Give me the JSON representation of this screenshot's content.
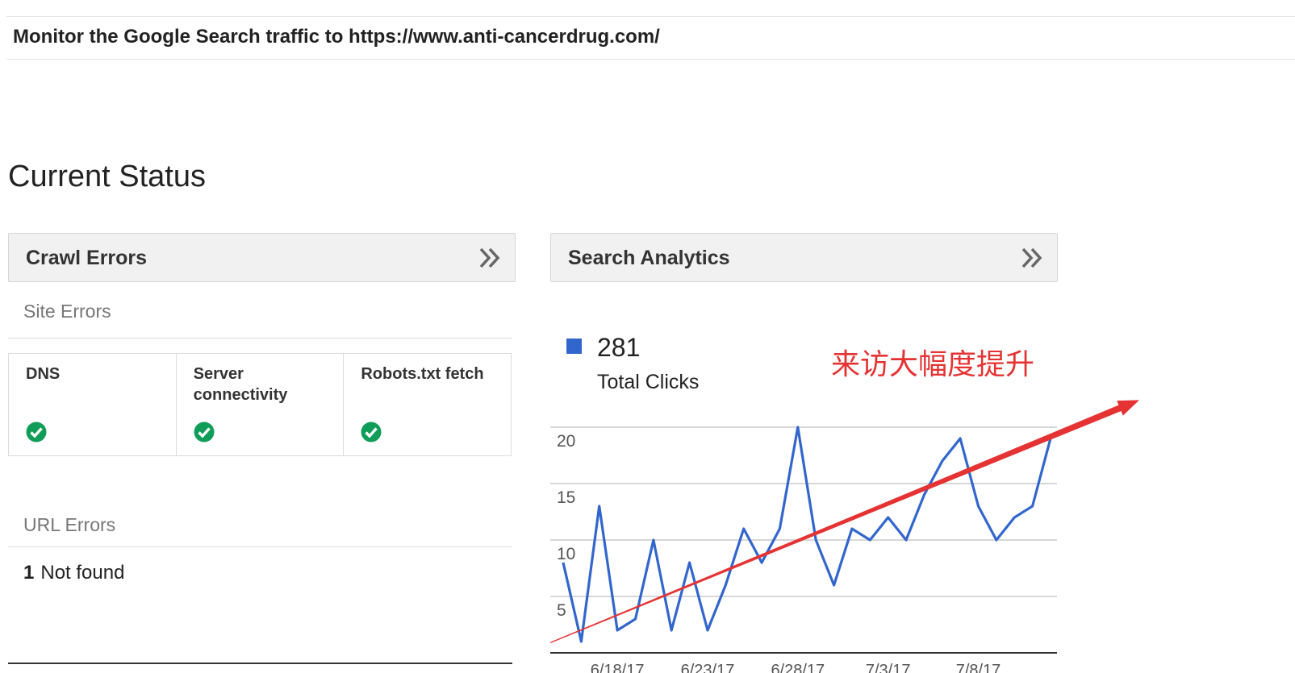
{
  "header": {
    "monitor_text": "Monitor the Google Search traffic to https://www.anti-cancerdrug.com/"
  },
  "page": {
    "section_title": "Current Status"
  },
  "crawl_errors": {
    "title": "Crawl Errors",
    "site_errors_label": "Site Errors",
    "columns": [
      {
        "label": "DNS",
        "status": "ok"
      },
      {
        "label": "Server\nconnectivity",
        "status": "ok"
      },
      {
        "label": "Robots.txt fetch",
        "status": "ok"
      }
    ],
    "url_errors_label": "URL Errors",
    "not_found_count": "1",
    "not_found_label": "Not found"
  },
  "search_analytics": {
    "title": "Search Analytics",
    "legend_value": "281",
    "legend_label": "Total Clicks",
    "annotation": "来访大幅度提升",
    "series_color": "#3366cc",
    "trend_color": "#e53333"
  },
  "chart_data": {
    "type": "line",
    "ylim": [
      0,
      20
    ],
    "y_ticks": [
      5,
      10,
      15,
      20
    ],
    "x_tick_labels": [
      "6/18/17",
      "6/23/17",
      "6/28/17",
      "7/3/17",
      "7/8/17"
    ],
    "x_tick_index": [
      3,
      8,
      13,
      18,
      23
    ],
    "series": [
      {
        "values": [
          8,
          1,
          13,
          2,
          3,
          10,
          2,
          8,
          2,
          6,
          11,
          8,
          11,
          20,
          10,
          6,
          11,
          10,
          12,
          10,
          14,
          17,
          19,
          13,
          10,
          12,
          13,
          19
        ]
      }
    ],
    "trendline": {
      "color": "#e53333",
      "from_value": 0.9,
      "to_value": 22.4
    }
  }
}
